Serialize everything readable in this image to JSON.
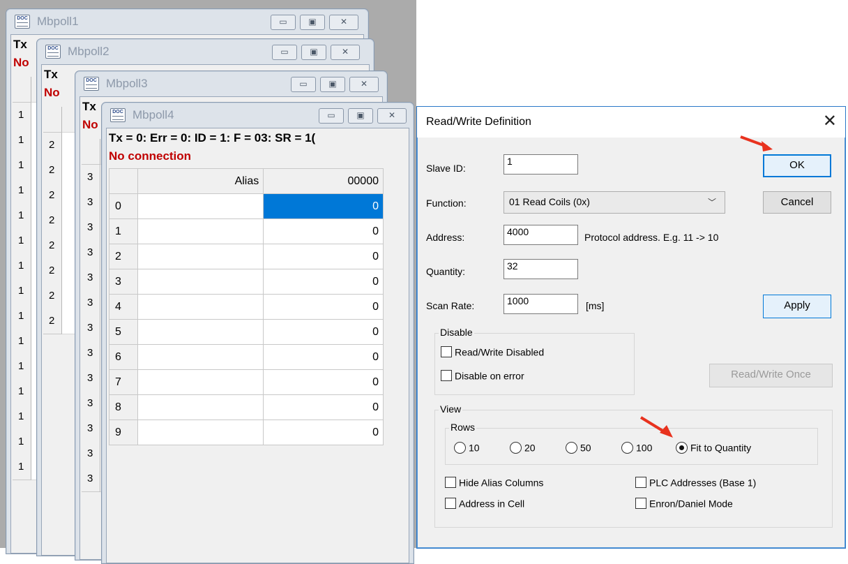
{
  "windows": {
    "w1": {
      "title": "Mbpoll1",
      "tx": "Tx",
      "conn": "No",
      "rows": [
        "1",
        "1",
        "1",
        "1",
        "1",
        "1",
        "1",
        "1",
        "1",
        "1",
        "1",
        "1",
        "1",
        "1",
        "1"
      ]
    },
    "w2": {
      "title": "Mbpoll2",
      "tx": "Tx",
      "conn": "No",
      "rows": [
        "2",
        "2",
        "2",
        "2",
        "2",
        "2",
        "2",
        "2"
      ]
    },
    "w3": {
      "title": "Mbpoll3",
      "tx": "Tx",
      "conn": "No",
      "rows": [
        "3",
        "3",
        "3",
        "3",
        "3",
        "3",
        "3",
        "3",
        "3",
        "3",
        "3",
        "3",
        "3"
      ]
    },
    "w4": {
      "title": "Mbpoll4",
      "status_line": "Tx = 0: Err = 0: ID = 1: F = 03: SR = 1(",
      "conn": "No connection",
      "table": {
        "alias_header": "Alias",
        "value_header": "00000",
        "rows": [
          {
            "index": "0",
            "value": "0"
          },
          {
            "index": "1",
            "value": "0"
          },
          {
            "index": "2",
            "value": "0"
          },
          {
            "index": "3",
            "value": "0"
          },
          {
            "index": "4",
            "value": "0"
          },
          {
            "index": "5",
            "value": "0"
          },
          {
            "index": "6",
            "value": "0"
          },
          {
            "index": "7",
            "value": "0"
          },
          {
            "index": "8",
            "value": "0"
          },
          {
            "index": "9",
            "value": "0"
          }
        ]
      }
    }
  },
  "window_buttons": {
    "minimize": "▭",
    "maximize": "▣",
    "close": "✕"
  },
  "dialog": {
    "title": "Read/Write Definition",
    "close": "✕",
    "slave_id_label": "Slave ID:",
    "slave_id_value": "1",
    "function_label": "Function:",
    "function_value": "01 Read Coils (0x)",
    "address_label": "Address:",
    "address_value": "4000",
    "address_hint": "Protocol address. E.g. 11 -> 10",
    "quantity_label": "Quantity:",
    "quantity_value": "32",
    "scan_rate_label": "Scan Rate:",
    "scan_rate_value": "1000",
    "scan_rate_unit": "[ms]",
    "ok": "OK",
    "cancel": "Cancel",
    "apply": "Apply",
    "rw_once": "Read/Write Once",
    "disable_group": "Disable",
    "rw_disabled": "Read/Write Disabled",
    "disable_on_error": "Disable on error",
    "view_group": "View",
    "rows_group": "Rows",
    "rows_options": [
      "10",
      "20",
      "50",
      "100",
      "Fit to Quantity"
    ],
    "rows_selected": "Fit to Quantity",
    "hide_alias": "Hide Alias Columns",
    "plc_addresses": "PLC Addresses (Base 1)",
    "address_in_cell": "Address in Cell",
    "enron_mode": "Enron/Daniel Mode"
  },
  "colors": {
    "selected_cell": "#0078d7",
    "connection_error": "#c00000",
    "annotation_arrow": "#e8321e"
  }
}
